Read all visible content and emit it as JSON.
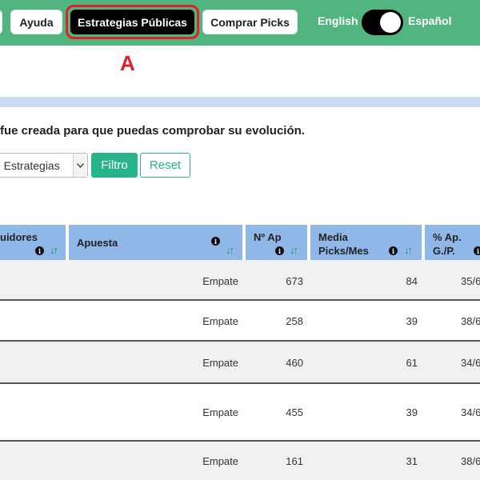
{
  "nav": {
    "buttons": [
      {
        "label": ""
      },
      {
        "label": "Ayuda"
      },
      {
        "label": "Estrategias Públicas"
      },
      {
        "label": "Comprar Picks"
      }
    ],
    "lang_en": "English",
    "lang_es": "Español"
  },
  "annotation": "A",
  "description": "fue creada para que puedas comprobar su evolución.",
  "filter": {
    "select_value": "e Estrategias",
    "filtro_label": "Filtro",
    "reset_label": "Reset"
  },
  "table": {
    "headers": [
      {
        "line1": "uidores",
        "line2": ""
      },
      {
        "line1": "Apuesta",
        "line2": ""
      },
      {
        "line1": "Nº Ap",
        "line2": ""
      },
      {
        "line1": "Media",
        "line2": "Picks/Mes"
      },
      {
        "line1": "% Ap.",
        "line2": "G./P."
      }
    ],
    "rows": [
      {
        "apuesta": "Empate",
        "n_ap": "673",
        "media": "84",
        "pct": "35/6"
      },
      {
        "apuesta": "Empate",
        "n_ap": "258",
        "media": "39",
        "pct": "38/6"
      },
      {
        "apuesta": "Empate",
        "n_ap": "460",
        "media": "61",
        "pct": "34/6"
      },
      {
        "apuesta": "Empate",
        "n_ap": "455",
        "media": "39",
        "pct": "34/6"
      },
      {
        "apuesta": "Empate",
        "n_ap": "161",
        "media": "31",
        "pct": "38/6"
      }
    ]
  },
  "icons": {
    "info": "info-icon",
    "sort": "sort-icon",
    "dropdown": "chevron-down-icon"
  },
  "colors": {
    "nav_bg": "#52b47f",
    "active_btn": "#000000",
    "highlight": "#e0202a",
    "header_bg": "#8fb8e8",
    "filtro_bg": "#27b48a"
  }
}
